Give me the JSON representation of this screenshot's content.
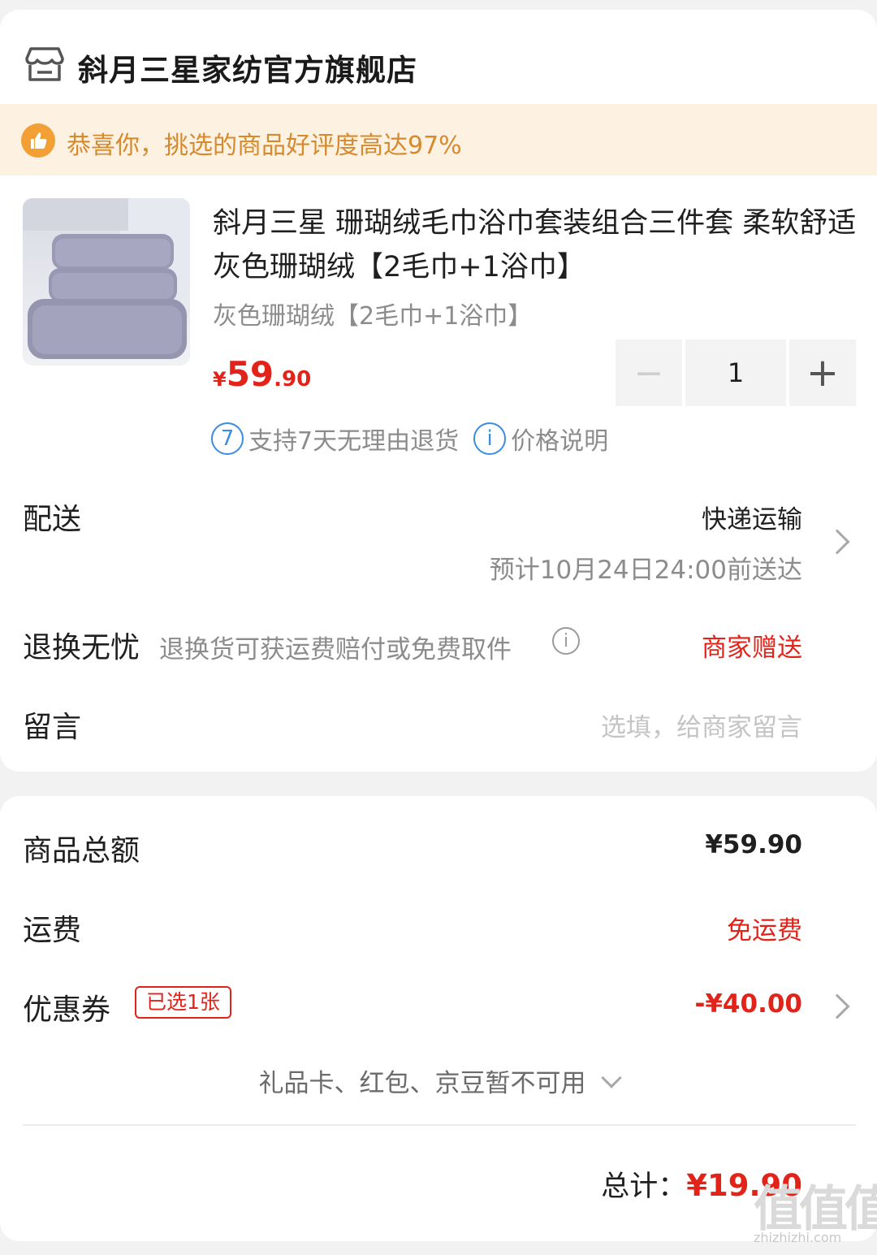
{
  "store": {
    "name": "斜月三星家纺官方旗舰店",
    "icon": "store-icon"
  },
  "banner": {
    "text": "恭喜你，挑选的商品好评度高达97%",
    "icon": "thumbs-up-icon",
    "color": "#d68a2e"
  },
  "product": {
    "title": "斜月三星 珊瑚绒毛巾浴巾套装组合三件套 柔软舒适 灰色珊瑚绒【2毛巾+1浴巾】",
    "spec": "灰色珊瑚绒【2毛巾+1浴巾】",
    "price": {
      "symbol": "¥",
      "integer": "59",
      "decimal": ".90"
    },
    "quantity": "1",
    "minus": "−",
    "plus": "+"
  },
  "services": [
    {
      "icon_text": "7",
      "label": "支持7天无理由退货"
    },
    {
      "icon_text": "i",
      "label": "价格说明"
    }
  ],
  "delivery": {
    "label": "配送",
    "method": "快递运输",
    "eta": "预计10月24日24:00前送达"
  },
  "returns": {
    "label": "退换无忧",
    "desc": "退换货可获运费赔付或免费取件",
    "info_icon": "i",
    "value": "商家赠送"
  },
  "message": {
    "label": "留言",
    "placeholder": "选填，给商家留言"
  },
  "summary": {
    "subtotal_label": "商品总额",
    "subtotal": "¥59.90",
    "shipping_label": "运费",
    "shipping": "免运费",
    "coupon_label": "优惠券",
    "coupon_badge": "已选1张",
    "coupon_value": "-¥40.00",
    "unavailable": "礼品卡、红包、京豆暂不可用",
    "total_label": "总计：",
    "total": "¥19.90"
  },
  "watermark": {
    "glyph": "值值值",
    "url": "zhizhizhi.com"
  },
  "colors": {
    "accent_red": "#e2231a",
    "info_blue": "#3a8de0",
    "banner_bg": "#fdf1e2"
  }
}
